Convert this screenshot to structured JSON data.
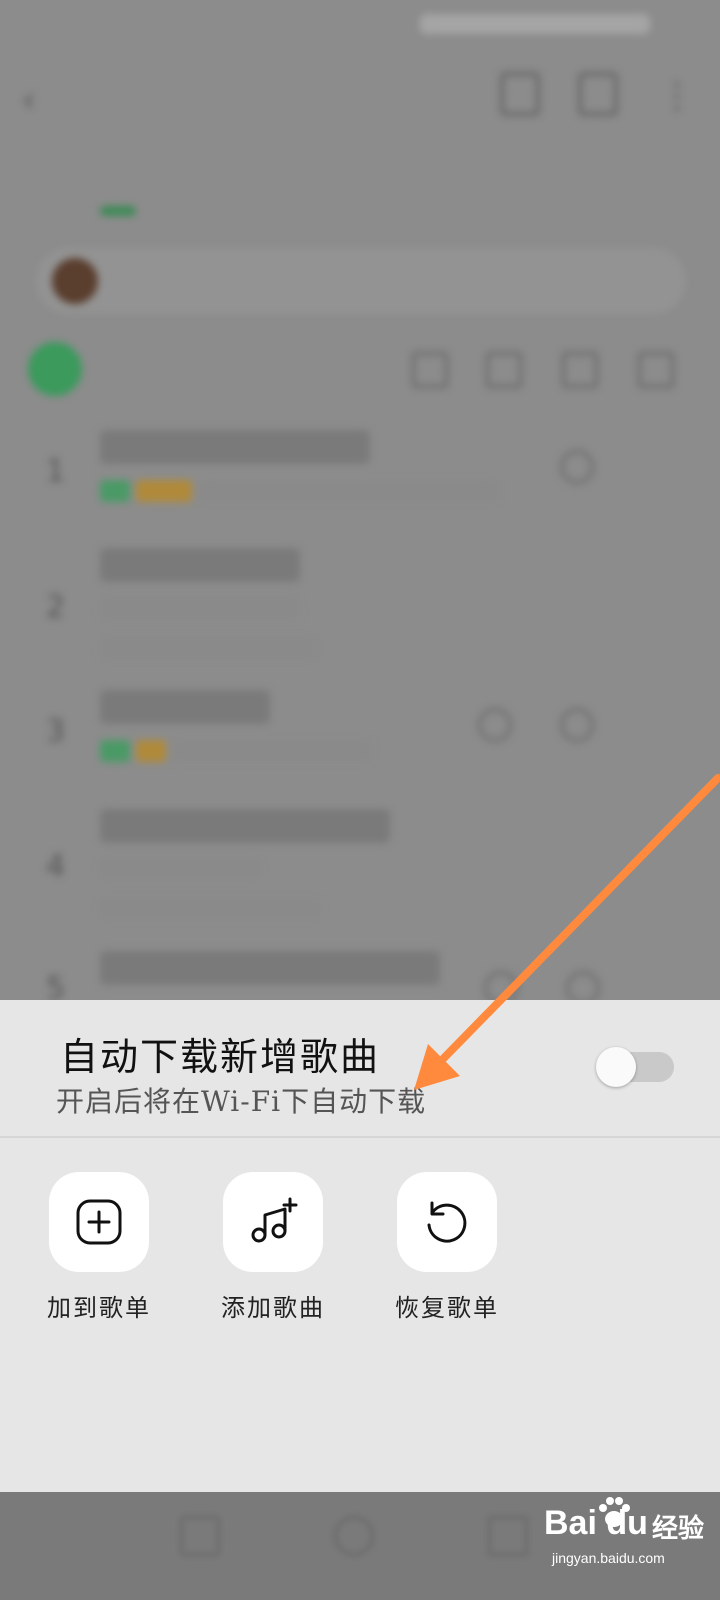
{
  "background_app": {
    "status_time": "",
    "header_title": "",
    "banner_text": "",
    "playall_label": "",
    "songs": [
      {
        "index": "1",
        "name": "",
        "meta": ""
      },
      {
        "index": "2",
        "name": "",
        "meta": ""
      },
      {
        "index": "3",
        "name": "",
        "meta": ""
      },
      {
        "index": "4",
        "name": "",
        "meta": ""
      },
      {
        "index": "5",
        "name": "",
        "meta": ""
      }
    ]
  },
  "sheet": {
    "auto_download": {
      "title": "自动下载新增歌曲",
      "subtitle": "开启后将在Wi-Fi下自动下载",
      "enabled": false
    },
    "actions": [
      {
        "label": "加到歌单",
        "icon": "add-square-icon"
      },
      {
        "label": "添加歌曲",
        "icon": "music-note-plus-icon"
      },
      {
        "label": "恢复歌单",
        "icon": "restore-icon"
      }
    ],
    "cancel_label": ""
  },
  "annotation": {
    "arrow_color": "#ff8a3d"
  },
  "watermark": {
    "logo_text": "Bai  du",
    "brand_cn": "经验",
    "url": "jingyan.baidu.com"
  },
  "colors": {
    "sheet_bg": "#e6e6e6",
    "tile_bg": "#ffffff",
    "toggle_off": "#c9c9c9",
    "accent_green": "#3c8a55"
  }
}
